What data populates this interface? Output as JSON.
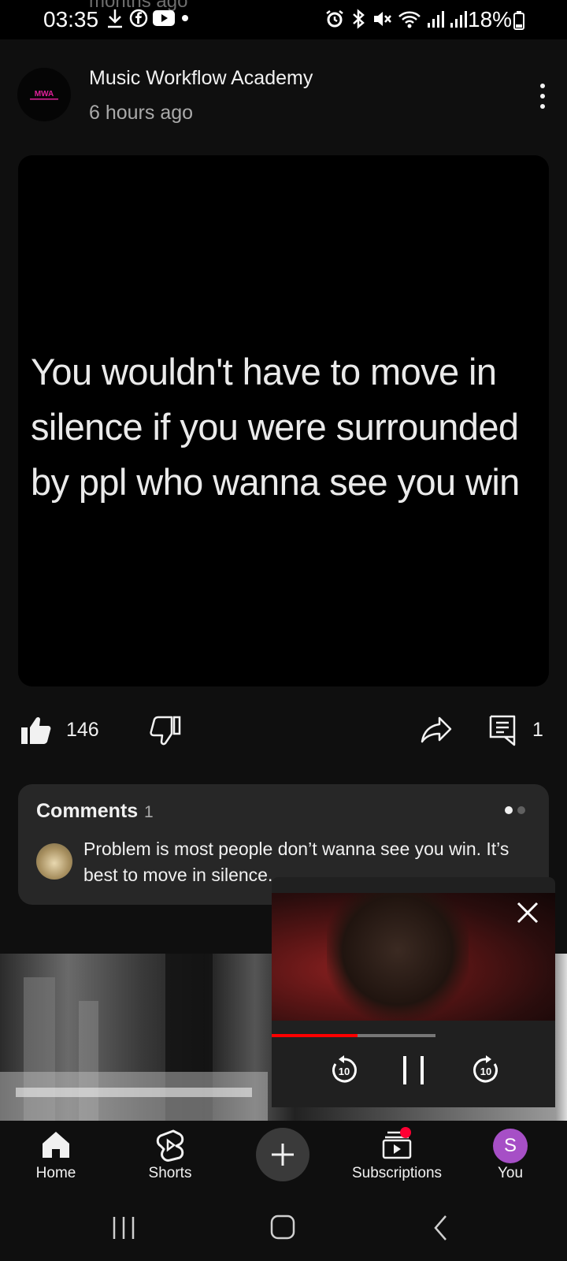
{
  "status_bar": {
    "time": "03:35",
    "battery": "18%",
    "behind_text": "months ago"
  },
  "post": {
    "channel_name": "Music Workflow Academy",
    "channel_initials": "MWA",
    "time_ago": "6 hours ago",
    "quote": "You wouldn't have to move in silence if you were surrounded by ppl who wanna see you win",
    "likes": "146",
    "comments_count": "1"
  },
  "comments": {
    "title": "Comments",
    "count": "1",
    "top_comment": "Problem is most people don’t wanna see you win. It’s best to move in silence."
  },
  "mini_player": {
    "progress": 0.31,
    "buffered": 0.59,
    "rewind_label": "10",
    "forward_label": "10"
  },
  "nav": {
    "home": "Home",
    "shorts": "Shorts",
    "subscriptions": "Subscriptions",
    "you": "You",
    "avatar_letter": "S"
  },
  "colors": {
    "background": "#0f0f0f",
    "card": "#272727",
    "accent_red": "#ff0000",
    "avatar_purple": "#a64fc6",
    "logo_pink": "#e0219a"
  }
}
